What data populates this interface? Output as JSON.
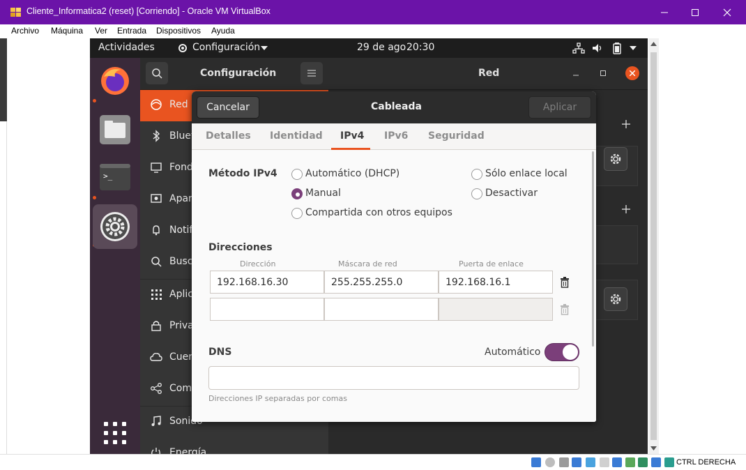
{
  "host": {
    "window_title": "Cliente_Informatica2 (reset) [Corriendo] - Oracle VM VirtualBox",
    "menu": [
      "Archivo",
      "Máquina",
      "Ver",
      "Entrada",
      "Dispositivos",
      "Ayuda"
    ],
    "host_key": "CTRL DERECHA",
    "accent": "#6b13a8"
  },
  "topbar": {
    "activities": "Actividades",
    "app_menu": "Configuración",
    "date": "29 de ago",
    "time": "20:30"
  },
  "settings": {
    "title": "Configuración",
    "panel_title": "Red",
    "sidebar": [
      {
        "label": "Red",
        "icon": "network-icon"
      },
      {
        "label": "Bluetooth",
        "icon": "bluetooth-icon"
      },
      {
        "label": "Fondo",
        "icon": "background-icon"
      },
      {
        "label": "Apariencia",
        "icon": "appearance-icon"
      },
      {
        "label": "Notificaciones",
        "icon": "bell-icon"
      },
      {
        "label": "Buscar",
        "icon": "search-icon"
      },
      {
        "label": "Aplicaciones",
        "icon": "apps-icon"
      },
      {
        "label": "Privacidad",
        "icon": "lock-icon"
      },
      {
        "label": "Cuentas en línea",
        "icon": "cloud-icon"
      },
      {
        "label": "Compartir",
        "icon": "share-icon"
      },
      {
        "label": "Sonido",
        "icon": "music-icon"
      },
      {
        "label": "Energía",
        "icon": "power-icon"
      }
    ]
  },
  "dialog": {
    "title": "Cableada",
    "cancel": "Cancelar",
    "apply": "Aplicar",
    "tabs": [
      "Detalles",
      "Identidad",
      "IPv4",
      "IPv6",
      "Seguridad"
    ],
    "active_tab": "IPv4",
    "method_label": "Método IPv4",
    "methods": [
      {
        "label": "Automático (DHCP)",
        "selected": false
      },
      {
        "label": "Manual",
        "selected": true
      },
      {
        "label": "Compartida con otros equipos",
        "selected": false
      },
      {
        "label": "Sólo enlace local",
        "selected": false
      },
      {
        "label": "Desactivar",
        "selected": false
      }
    ],
    "addresses_label": "Direcciones",
    "columns": [
      "Dirección",
      "Máscara de red",
      "Puerta de enlace"
    ],
    "rows": [
      [
        "192.168.16.30",
        "255.255.255.0",
        "192.168.16.1"
      ],
      [
        "",
        "",
        ""
      ]
    ],
    "dns_label": "DNS",
    "dns_auto_label": "Automático",
    "dns_auto_on": true,
    "dns_value": "",
    "dns_hint": "Direcciones IP separadas por comas",
    "accent": "#7b3f7a"
  }
}
